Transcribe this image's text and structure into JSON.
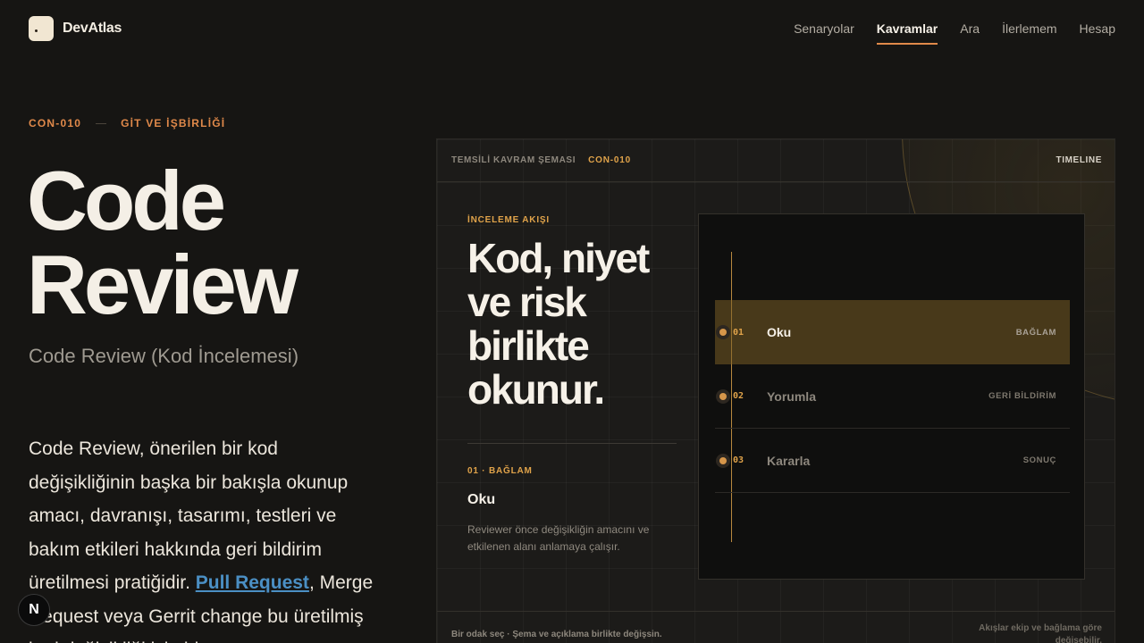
{
  "brand": {
    "name": "DevAtlas",
    "logo_icon": "devatlas-logo-icon"
  },
  "nav": {
    "items": [
      {
        "label": "Senaryolar",
        "active": false
      },
      {
        "label": "Kavramlar",
        "active": true
      },
      {
        "label": "Ara",
        "active": false
      },
      {
        "label": "İlerlemem",
        "active": false
      },
      {
        "label": "Hesap",
        "active": false
      }
    ]
  },
  "concept": {
    "code": "CON-010",
    "category": "GİT VE İŞBİRLİĞİ",
    "title_line1": "Code",
    "title_line2": "Review",
    "subtitle": "Code Review (Kod İncelemesi)",
    "body_before_link": "Code Review, önerilen bir kod değişikliğinin başka bir bakışla okunup amacı, davranışı, tasarımı, testleri ve bakım etkileri hakkında geri bildirim üretilmesi pratiğidir. ",
    "body_link": "Pull Request",
    "body_after_link": ", Merge Request veya Gerrit change bu üretilmiş kod değişikliği için bir"
  },
  "fab": {
    "label": "N",
    "icon": "next-logo-icon"
  },
  "panel": {
    "kicker": "TEMSİLİ KAVRAM ŞEMASI",
    "code": "CON-010",
    "mode": "TIMELINE",
    "flow_label": "İNCELEME AKIŞI",
    "headline": "Kod, niyet ve risk birlikte okunur.",
    "selected_step_label": "01 · BAĞLAM",
    "selected_step_title": "Oku",
    "selected_step_desc": "Reviewer önce değişikliğin amacını ve etkilenen alanı anlamaya çalışır.",
    "steps": [
      {
        "num": "01",
        "name": "Oku",
        "tag": "BAĞLAM",
        "active": true
      },
      {
        "num": "02",
        "name": "Yorumla",
        "tag": "GERİ BİLDİRİM",
        "active": false
      },
      {
        "num": "03",
        "name": "Kararla",
        "tag": "SONUÇ",
        "active": false
      }
    ],
    "footer_left": "Bir odak seç · Şema ve açıklama birlikte değişsin.",
    "footer_right": "Akışlar ekip ve bağlama göre değişebilir."
  },
  "colors": {
    "accent": "#e0894a",
    "gold": "#e0a34a",
    "link": "#4b8fc4",
    "background": "#161513"
  }
}
